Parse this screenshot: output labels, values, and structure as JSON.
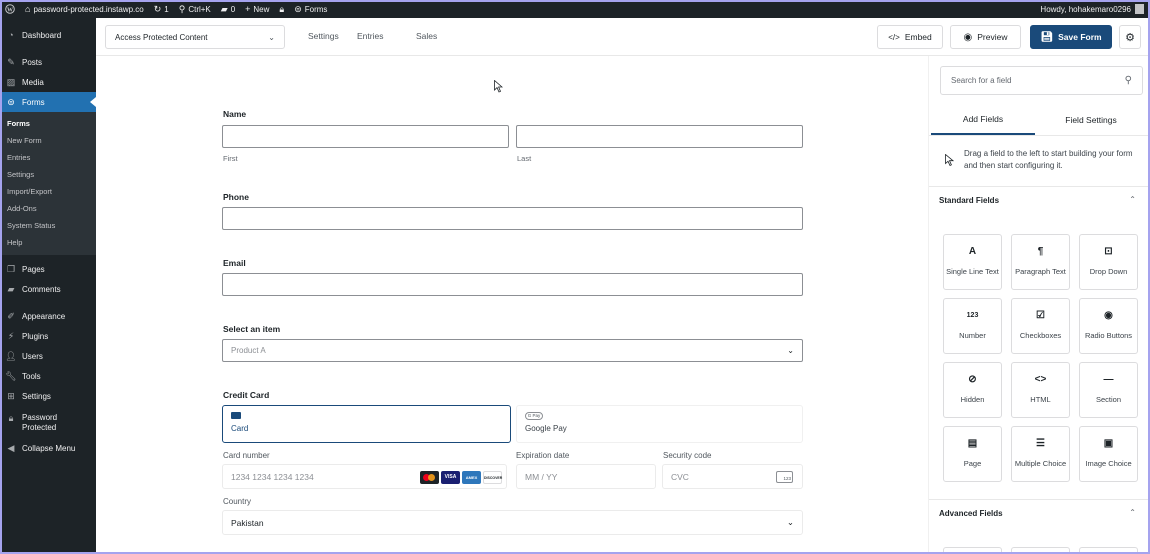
{
  "adminbar": {
    "site_name": "password-protected.instawp.co",
    "updates_count": "1",
    "search_shortcut": "Ctrl+K",
    "comments_count": "0",
    "new_label": "New",
    "forms_label": "Forms",
    "howdy": "Howdy, hohakemaro0296"
  },
  "sidebar": {
    "items_top": [
      {
        "label": "Dashboard",
        "icon": "dashboard-icon"
      },
      {
        "label": "Posts",
        "icon": "pin-icon"
      },
      {
        "label": "Media",
        "icon": "media-icon"
      },
      {
        "label": "Forms",
        "icon": "forms-icon"
      }
    ],
    "submenu": [
      "Forms",
      "New Form",
      "Entries",
      "Settings",
      "Import/Export",
      "Add-Ons",
      "System Status",
      "Help"
    ],
    "items_bottom": [
      {
        "label": "Pages"
      },
      {
        "label": "Comments"
      },
      {
        "label": "Appearance"
      },
      {
        "label": "Plugins"
      },
      {
        "label": "Users"
      },
      {
        "label": "Tools"
      },
      {
        "label": "Settings"
      },
      {
        "label": "Password Protected"
      },
      {
        "label": "Collapse Menu"
      }
    ]
  },
  "toolbar": {
    "form_select": "Access Protected Content",
    "tabs": [
      "Settings",
      "Entries",
      "Sales"
    ],
    "embed": "Embed",
    "preview": "Preview",
    "save": "Save Form"
  },
  "form": {
    "name_label": "Name",
    "first_sub": "First",
    "last_sub": "Last",
    "phone_label": "Phone",
    "email_label": "Email",
    "select_label": "Select an item",
    "select_value": "Product A",
    "cc_label": "Credit Card",
    "pay_card": "Card",
    "pay_google": "Google Pay",
    "gpay_badge": "G Pay",
    "card_number_label": "Card number",
    "card_number_placeholder": "1234 1234 1234 1234",
    "expiry_label": "Expiration date",
    "expiry_placeholder": "MM / YY",
    "cvc_label": "Security code",
    "cvc_placeholder": "CVC",
    "cvc_icon_text": "123",
    "country_label": "Country",
    "country_value": "Pakistan",
    "card_logo_texts": [
      "",
      "VISA",
      "AMEX",
      "DISCOVER"
    ]
  },
  "panel": {
    "search_placeholder": "Search for a field",
    "tab_add": "Add Fields",
    "tab_settings": "Field Settings",
    "hint": "Drag a field to the left to start building your form and then start configuring it.",
    "standard_title": "Standard Fields",
    "advanced_title": "Advanced Fields",
    "tiles": [
      {
        "label": "Single Line Text",
        "icon": "A"
      },
      {
        "label": "Paragraph Text",
        "icon": "¶"
      },
      {
        "label": "Drop Down",
        "icon": "⊡"
      },
      {
        "label": "Number",
        "icon": "123"
      },
      {
        "label": "Checkboxes",
        "icon": "☑"
      },
      {
        "label": "Radio Buttons",
        "icon": "◉"
      },
      {
        "label": "Hidden",
        "icon": "⊘"
      },
      {
        "label": "HTML",
        "icon": "<>"
      },
      {
        "label": "Section",
        "icon": "—"
      },
      {
        "label": "Page",
        "icon": "▤"
      },
      {
        "label": "Multiple Choice",
        "icon": "☰"
      },
      {
        "label": "Image Choice",
        "icon": "▣"
      }
    ]
  }
}
